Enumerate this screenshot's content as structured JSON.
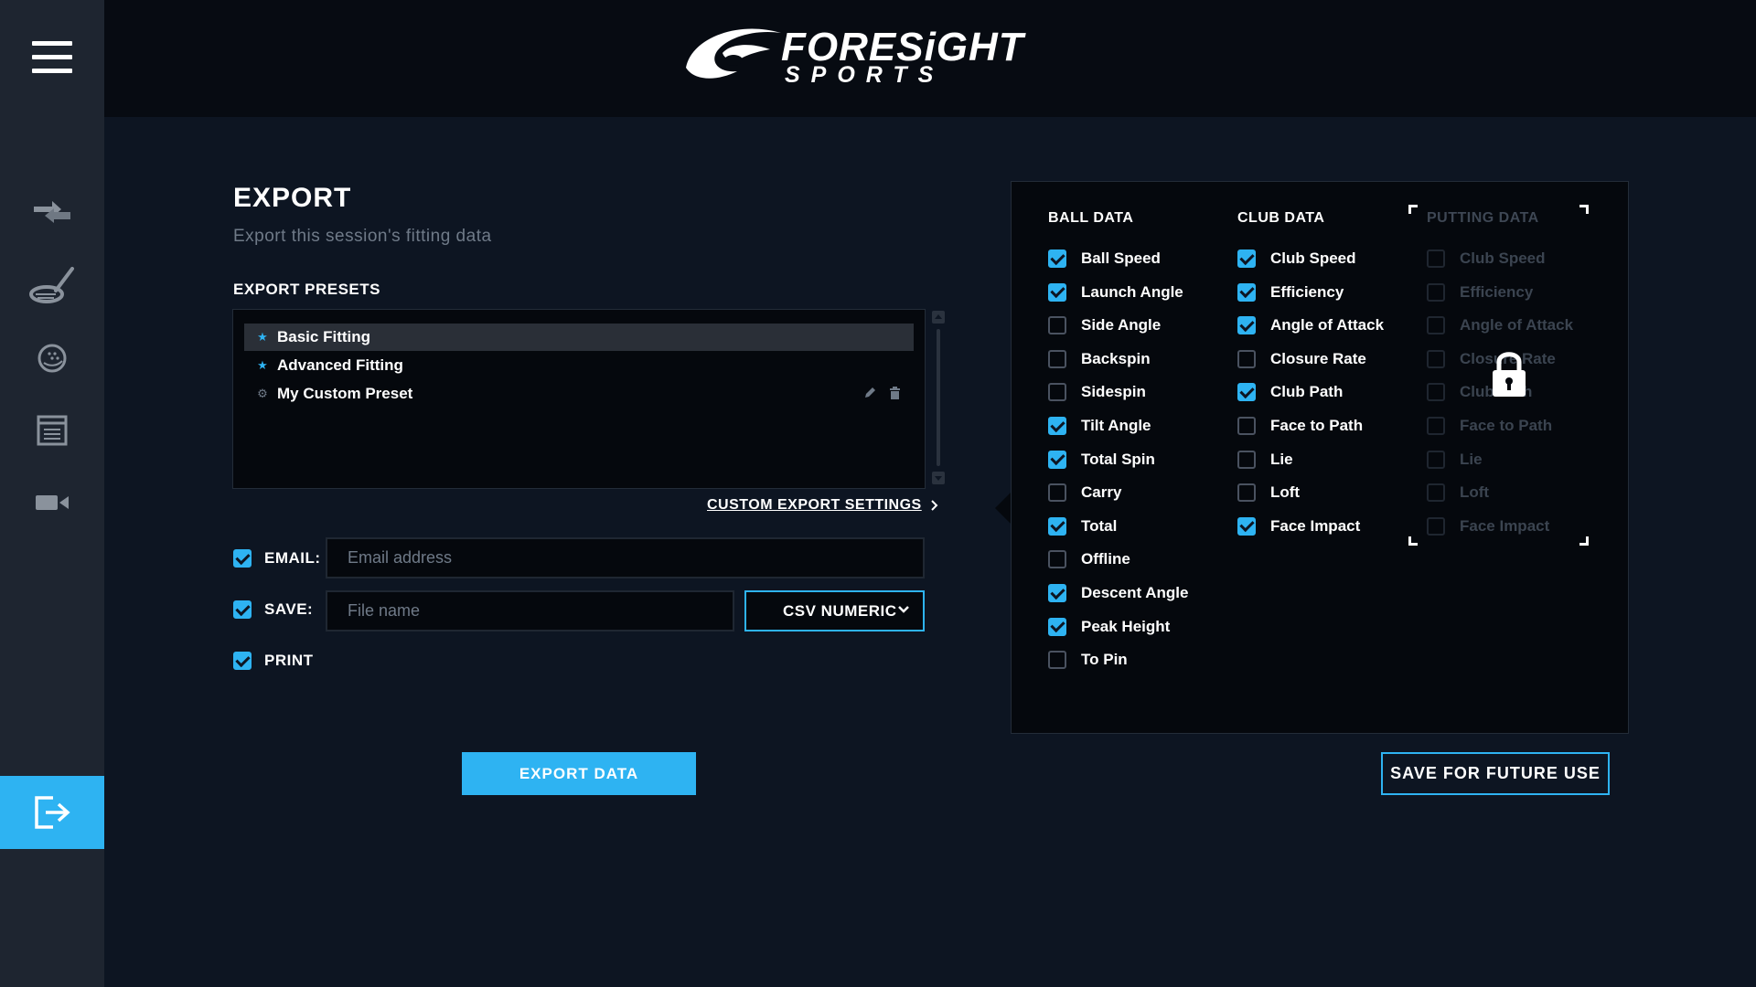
{
  "brand": {
    "name": "FORESiGHT",
    "sub": "SPORTS"
  },
  "export": {
    "title": "EXPORT",
    "subtitle": "Export this session's fitting data",
    "presets_label": "EXPORT PRESETS",
    "presets": [
      {
        "label": "Basic Fitting",
        "icon": "star-icon",
        "selected": true
      },
      {
        "label": "Advanced Fitting",
        "icon": "star-icon",
        "selected": false
      },
      {
        "label": "My Custom Preset",
        "icon": "gear-icon",
        "selected": false
      }
    ],
    "custom_link": "CUSTOM EXPORT SETTINGS",
    "email_label": "EMAIL:",
    "email_placeholder": "Email address",
    "email_checked": true,
    "save_label": "SAVE:",
    "save_placeholder": "File name",
    "save_checked": true,
    "format": "CSV NUMERIC",
    "print_label": "PRINT",
    "print_checked": true,
    "export_button": "EXPORT DATA",
    "save_future_button": "SAVE FOR FUTURE USE"
  },
  "data_columns": {
    "ball": {
      "title": "BALL DATA",
      "items": [
        {
          "label": "Ball Speed",
          "checked": true
        },
        {
          "label": "Launch Angle",
          "checked": true
        },
        {
          "label": "Side Angle",
          "checked": false
        },
        {
          "label": "Backspin",
          "checked": false
        },
        {
          "label": "Sidespin",
          "checked": false
        },
        {
          "label": "Tilt Angle",
          "checked": true
        },
        {
          "label": "Total Spin",
          "checked": true
        },
        {
          "label": "Carry",
          "checked": false
        },
        {
          "label": "Total",
          "checked": true
        },
        {
          "label": "Offline",
          "checked": false
        },
        {
          "label": "Descent Angle",
          "checked": true
        },
        {
          "label": "Peak Height",
          "checked": true
        },
        {
          "label": "To Pin",
          "checked": false
        }
      ]
    },
    "club": {
      "title": "CLUB DATA",
      "items": [
        {
          "label": "Club Speed",
          "checked": true
        },
        {
          "label": "Efficiency",
          "checked": true
        },
        {
          "label": "Angle of Attack",
          "checked": true
        },
        {
          "label": "Closure Rate",
          "checked": false
        },
        {
          "label": "Club Path",
          "checked": true
        },
        {
          "label": "Face to Path",
          "checked": false
        },
        {
          "label": "Lie",
          "checked": false
        },
        {
          "label": "Loft",
          "checked": false
        },
        {
          "label": "Face Impact",
          "checked": true
        }
      ]
    },
    "putting": {
      "title": "PUTTING DATA",
      "locked": true,
      "items": [
        {
          "label": "Club Speed",
          "checked": false
        },
        {
          "label": "Efficiency",
          "checked": false
        },
        {
          "label": "Angle of Attack",
          "checked": false
        },
        {
          "label": "Closure Rate",
          "checked": false
        },
        {
          "label": "Club Path",
          "checked": false
        },
        {
          "label": "Face to Path",
          "checked": false
        },
        {
          "label": "Lie",
          "checked": false
        },
        {
          "label": "Loft",
          "checked": false
        },
        {
          "label": "Face Impact",
          "checked": false
        }
      ]
    }
  },
  "colors": {
    "accent": "#2eb3f2",
    "background": "#0d1522",
    "sidebar": "#1e2530"
  }
}
